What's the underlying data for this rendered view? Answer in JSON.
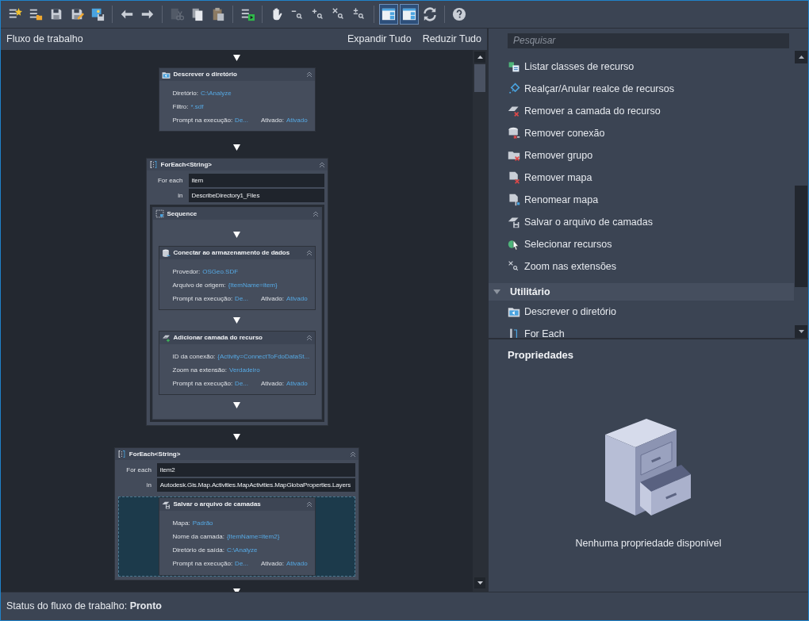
{
  "toolbar": [
    [
      {
        "kind": "button",
        "disabled": false
      },
      {
        "kind": "button",
        "disabled": false
      },
      {
        "kind": "button",
        "disabled": false
      },
      {
        "kind": "button",
        "disabled": false
      },
      {
        "kind": "button",
        "disabled": false
      }
    ],
    [
      {
        "kind": "button",
        "disabled": false
      },
      {
        "kind": "button",
        "disabled": false
      }
    ],
    [
      {
        "kind": "button",
        "disabled": true
      },
      {
        "kind": "button",
        "disabled": false
      },
      {
        "kind": "button",
        "disabled": false
      }
    ],
    [
      {
        "kind": "button",
        "disabled": false
      }
    ],
    [
      {
        "kind": "button",
        "disabled": false
      },
      {
        "kind": "button",
        "disabled": false
      },
      {
        "kind": "button",
        "disabled": false
      },
      {
        "kind": "button",
        "disabled": false
      },
      {
        "kind": "button",
        "disabled": false
      }
    ],
    [
      {
        "kind": "toggle",
        "selected": true
      },
      {
        "kind": "toggle",
        "selected": true
      },
      {
        "kind": "button",
        "disabled": false
      }
    ],
    [
      {
        "kind": "button",
        "disabled": false
      }
    ]
  ],
  "workflow": {
    "title": "Fluxo de trabalho",
    "actions": [
      "Expandir Tudo",
      "Reduzir Tudo"
    ],
    "activities": [
      {
        "kind": "activity",
        "title": "Descrever o diretório",
        "rows": [
          [
            {
              "label": "Diretório:",
              "value": "C:\\Analyze"
            }
          ],
          [
            {
              "label": "Filtro:",
              "value": "*.sdf"
            }
          ],
          [
            {
              "label": "Prompt na execução:",
              "value": "De..."
            },
            {
              "label": "Ativado:",
              "value": "Ativado"
            }
          ]
        ]
      },
      {
        "kind": "foreach",
        "title": "ForEach<String>",
        "fields": [
          {
            "label": "For each",
            "value": "item"
          },
          {
            "label": "in",
            "value": "DescribeDirectory1_Files"
          }
        ],
        "body": {
          "kind": "sequence",
          "title": "Sequence",
          "activities": [
            {
              "kind": "activity",
              "title": "Conectar ao armazenamento de dados",
              "rows": [
                [
                  {
                    "label": "Provedor:",
                    "value": "OSGeo.SDF"
                  }
                ],
                [
                  {
                    "label": "Arquivo de origem:",
                    "value": "{ItemName=item}"
                  }
                ],
                [
                  {
                    "label": "Prompt na execução:",
                    "value": "De..."
                  },
                  {
                    "label": "Ativado:",
                    "value": "Ativado"
                  }
                ]
              ]
            },
            {
              "kind": "activity",
              "title": "Adicionar camada do recurso",
              "rows": [
                [
                  {
                    "label": "ID da conexão:",
                    "value": "{Activity=ConnectToFdoDataSt..."
                  }
                ],
                [
                  {
                    "label": "Zoom na extensão:",
                    "value": "Verdadeiro"
                  }
                ],
                [
                  {
                    "label": "Prompt na execução:",
                    "value": "De..."
                  },
                  {
                    "label": "Ativado:",
                    "value": "Ativado"
                  }
                ]
              ]
            }
          ]
        }
      },
      {
        "kind": "foreach",
        "title": "ForEach<String>",
        "fields": [
          {
            "label": "For each",
            "value": "item2"
          },
          {
            "label": "in",
            "value": "Autodesk.Gis.Map.Activities.MapActivities.MapGlobaProperties.Layers"
          }
        ],
        "body": {
          "kind": "drop_zone",
          "activities": [
            {
              "kind": "activity",
              "title": "Salvar o arquivo de camadas",
              "rows": [
                [
                  {
                    "label": "Mapa:",
                    "value": "Padrão"
                  }
                ],
                [
                  {
                    "label": "Nome da camada:",
                    "value": "{ItemName=item2}"
                  }
                ],
                [
                  {
                    "label": "Diretório de saída:",
                    "value": "C:\\Analyze"
                  }
                ],
                [
                  {
                    "label": "Prompt na execução:",
                    "value": "De..."
                  },
                  {
                    "label": "Ativado:",
                    "value": "Ativado"
                  }
                ]
              ]
            }
          ]
        }
      }
    ]
  },
  "toolbox": {
    "search": {
      "placeholder": "Pesquisar"
    },
    "items": [
      {
        "kind": "item",
        "label": "Listar classes de recurso"
      },
      {
        "kind": "item",
        "label": "Realçar/Anular realce de recursos"
      },
      {
        "kind": "item",
        "label": "Remover a camada do recurso"
      },
      {
        "kind": "item",
        "label": "Remover conexão"
      },
      {
        "kind": "item",
        "label": "Remover grupo"
      },
      {
        "kind": "item",
        "label": "Remover mapa"
      },
      {
        "kind": "item",
        "label": "Renomear mapa"
      },
      {
        "kind": "item",
        "label": "Salvar o arquivo de camadas"
      },
      {
        "kind": "item",
        "label": "Selecionar recursos"
      },
      {
        "kind": "item",
        "label": "Zoom nas extensões"
      },
      {
        "kind": "category",
        "label": "Utilitário",
        "expanded": true
      },
      {
        "kind": "item",
        "label": "Descrever o diretório"
      },
      {
        "kind": "item",
        "label": "For Each"
      }
    ]
  },
  "properties": {
    "title": "Propriedades",
    "empty_message": "Nenhuma propriedade disponível"
  },
  "status_bar": "Status do fluxo de trabalho: **Pronto**"
}
